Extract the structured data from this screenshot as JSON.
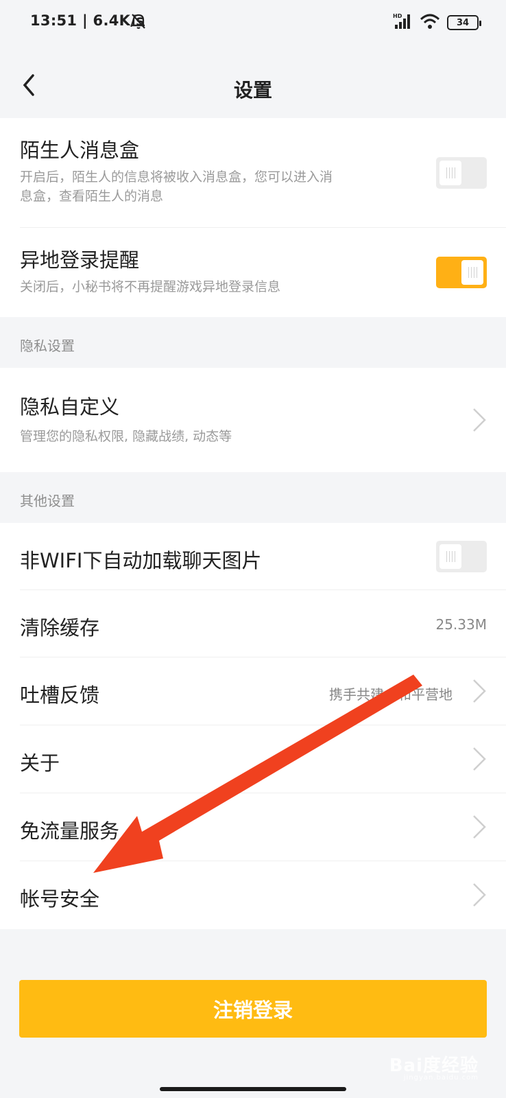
{
  "status_bar": {
    "time": "13:51 | 6.4K/s",
    "battery": "34",
    "icons": [
      "mute-bell-icon",
      "hd-signal-icon",
      "wifi-icon",
      "battery-icon"
    ]
  },
  "header": {
    "title": "设置",
    "back_icon": "chevron-left-icon"
  },
  "rows": {
    "stranger_box": {
      "label": "陌生人消息盒",
      "desc_line1": "开启后，陌生人的信息将被收入消息盒，您可以进入消",
      "desc_line2": "息盒，查看陌生人的消息",
      "toggle": "off"
    },
    "remote_login": {
      "label": "异地登录提醒",
      "desc": "关闭后，小秘书将不再提醒游戏异地登录信息",
      "toggle": "on"
    },
    "privacy_custom": {
      "label": "隐私自定义",
      "desc": "管理您的隐私权限, 隐藏战绩, 动态等"
    },
    "auto_load_images": {
      "label": "非WIFI下自动加载聊天图片",
      "toggle": "off"
    },
    "clear_cache": {
      "label": "清除缓存",
      "value": "25.33M"
    },
    "feedback": {
      "label": "吐槽反馈",
      "value": "携手共建，和平营地"
    },
    "about": {
      "label": "关于"
    },
    "free_data": {
      "label": "免流量服务"
    },
    "account_security": {
      "label": "帐号安全"
    }
  },
  "sections": {
    "privacy": "隐私设置",
    "other": "其他设置"
  },
  "logout_button": "注销登录",
  "watermark": {
    "brand": "Bai度经验",
    "url": "jingyan.baidu.com"
  },
  "colors": {
    "accent": "#ffb015",
    "annotation_arrow": "#f0411f",
    "background": "#f4f5f7"
  }
}
